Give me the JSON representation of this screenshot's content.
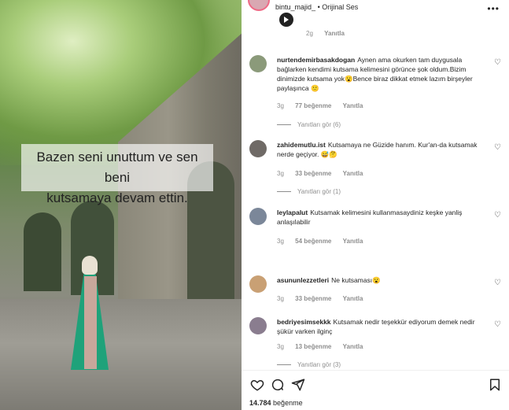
{
  "header": {
    "username": "bintu_majid_",
    "separator": "•",
    "audio": "Orijinal Ses",
    "more": "•••"
  },
  "post": {
    "caption_line1": "Bazen seni unuttum ve sen beni",
    "caption_line2": "kutsamaya devam ettin."
  },
  "top_reply": {
    "time": "2g",
    "reply_label": "Yanıtla"
  },
  "comments": [
    {
      "username": "nurtendemirbasakdogan",
      "text": "Aynen ama okurken tam duygusala bağlarken kendimi kutsama kelimesini görünce şok oldum.Bizim dinimizde kutsama yok😮Bence biraz dikkat etmek lazım birşeyler paylaşınca 🙂",
      "time": "3g",
      "likes": "77 beğenme",
      "reply_label": "Yanıtla",
      "view_replies": "Yanıtları gör (6)",
      "avatar_color": "#8b9a7a"
    },
    {
      "username": "zahidemutlu.ist",
      "text": "Kutsamaya ne Güzide hanım. Kur'an-da kutsamak nerde geçiyor. 😅🤔",
      "time": "3g",
      "likes": "33 beğenme",
      "reply_label": "Yanıtla",
      "view_replies": "Yanıtları gör (1)",
      "avatar_color": "#6f6a66"
    },
    {
      "username": "leylapalut",
      "text": "Kutsamak kelimesini kullanmasaydiniz keşke yanliş anlaşılabilir",
      "time": "3g",
      "likes": "54 beğenme",
      "reply_label": "Yanıtla",
      "view_replies": "",
      "avatar_color": "#7b8799"
    },
    {
      "username": "asununlezzetleri",
      "text": "Ne kutsaması😮",
      "time": "3g",
      "likes": "33 beğenme",
      "reply_label": "Yanıtla",
      "view_replies": "",
      "avatar_color": "#c9a074"
    },
    {
      "username": "bedriyesimsekkk",
      "text": "Kutsamak nedir teşekkür ediyorum demek nedir şükür varken ilginç",
      "time": "3g",
      "likes": "13 beğenme",
      "reply_label": "Yanıtla",
      "view_replies": "Yanıtları gör (3)",
      "avatar_color": "#8a7d8f"
    }
  ],
  "actions": {
    "like_icon": "heart-icon",
    "comment_icon": "comment-icon",
    "share_icon": "share-icon",
    "save_icon": "bookmark-icon"
  },
  "likes_count": "14.784",
  "likes_label": "beğenme"
}
